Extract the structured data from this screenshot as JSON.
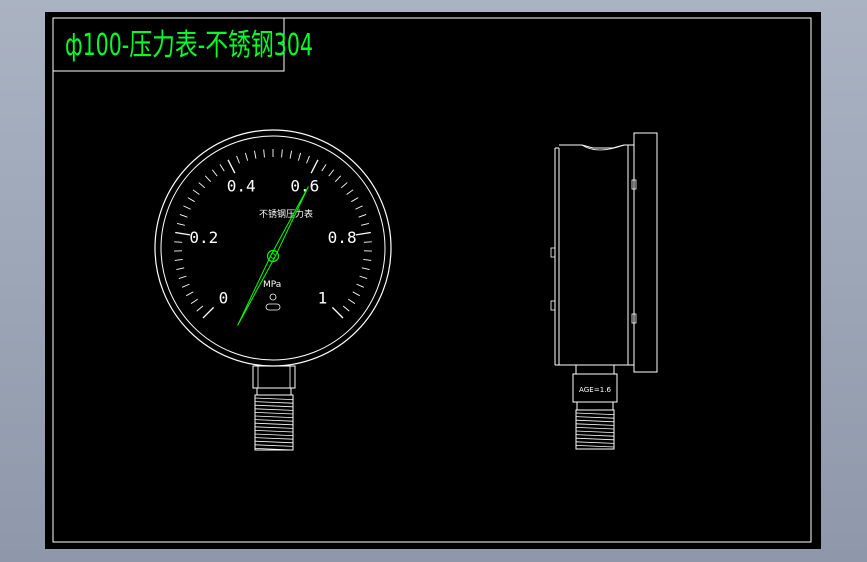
{
  "title": "ф100-压力表-不锈钢304",
  "dial": {
    "labels": [
      "0",
      "0.2",
      "0.4",
      "0.6",
      "0.8",
      "1"
    ],
    "brand_text": "不锈钢压力表",
    "unit": "MPa",
    "needle_value": 0.6
  },
  "side_view": {
    "grade_text": "AGE=1.6"
  },
  "colors": {
    "title": "#00ff2a",
    "needle": "#00ff00",
    "lines": "#ffffff",
    "background": "#000000",
    "viewport": "#a3adbd"
  }
}
